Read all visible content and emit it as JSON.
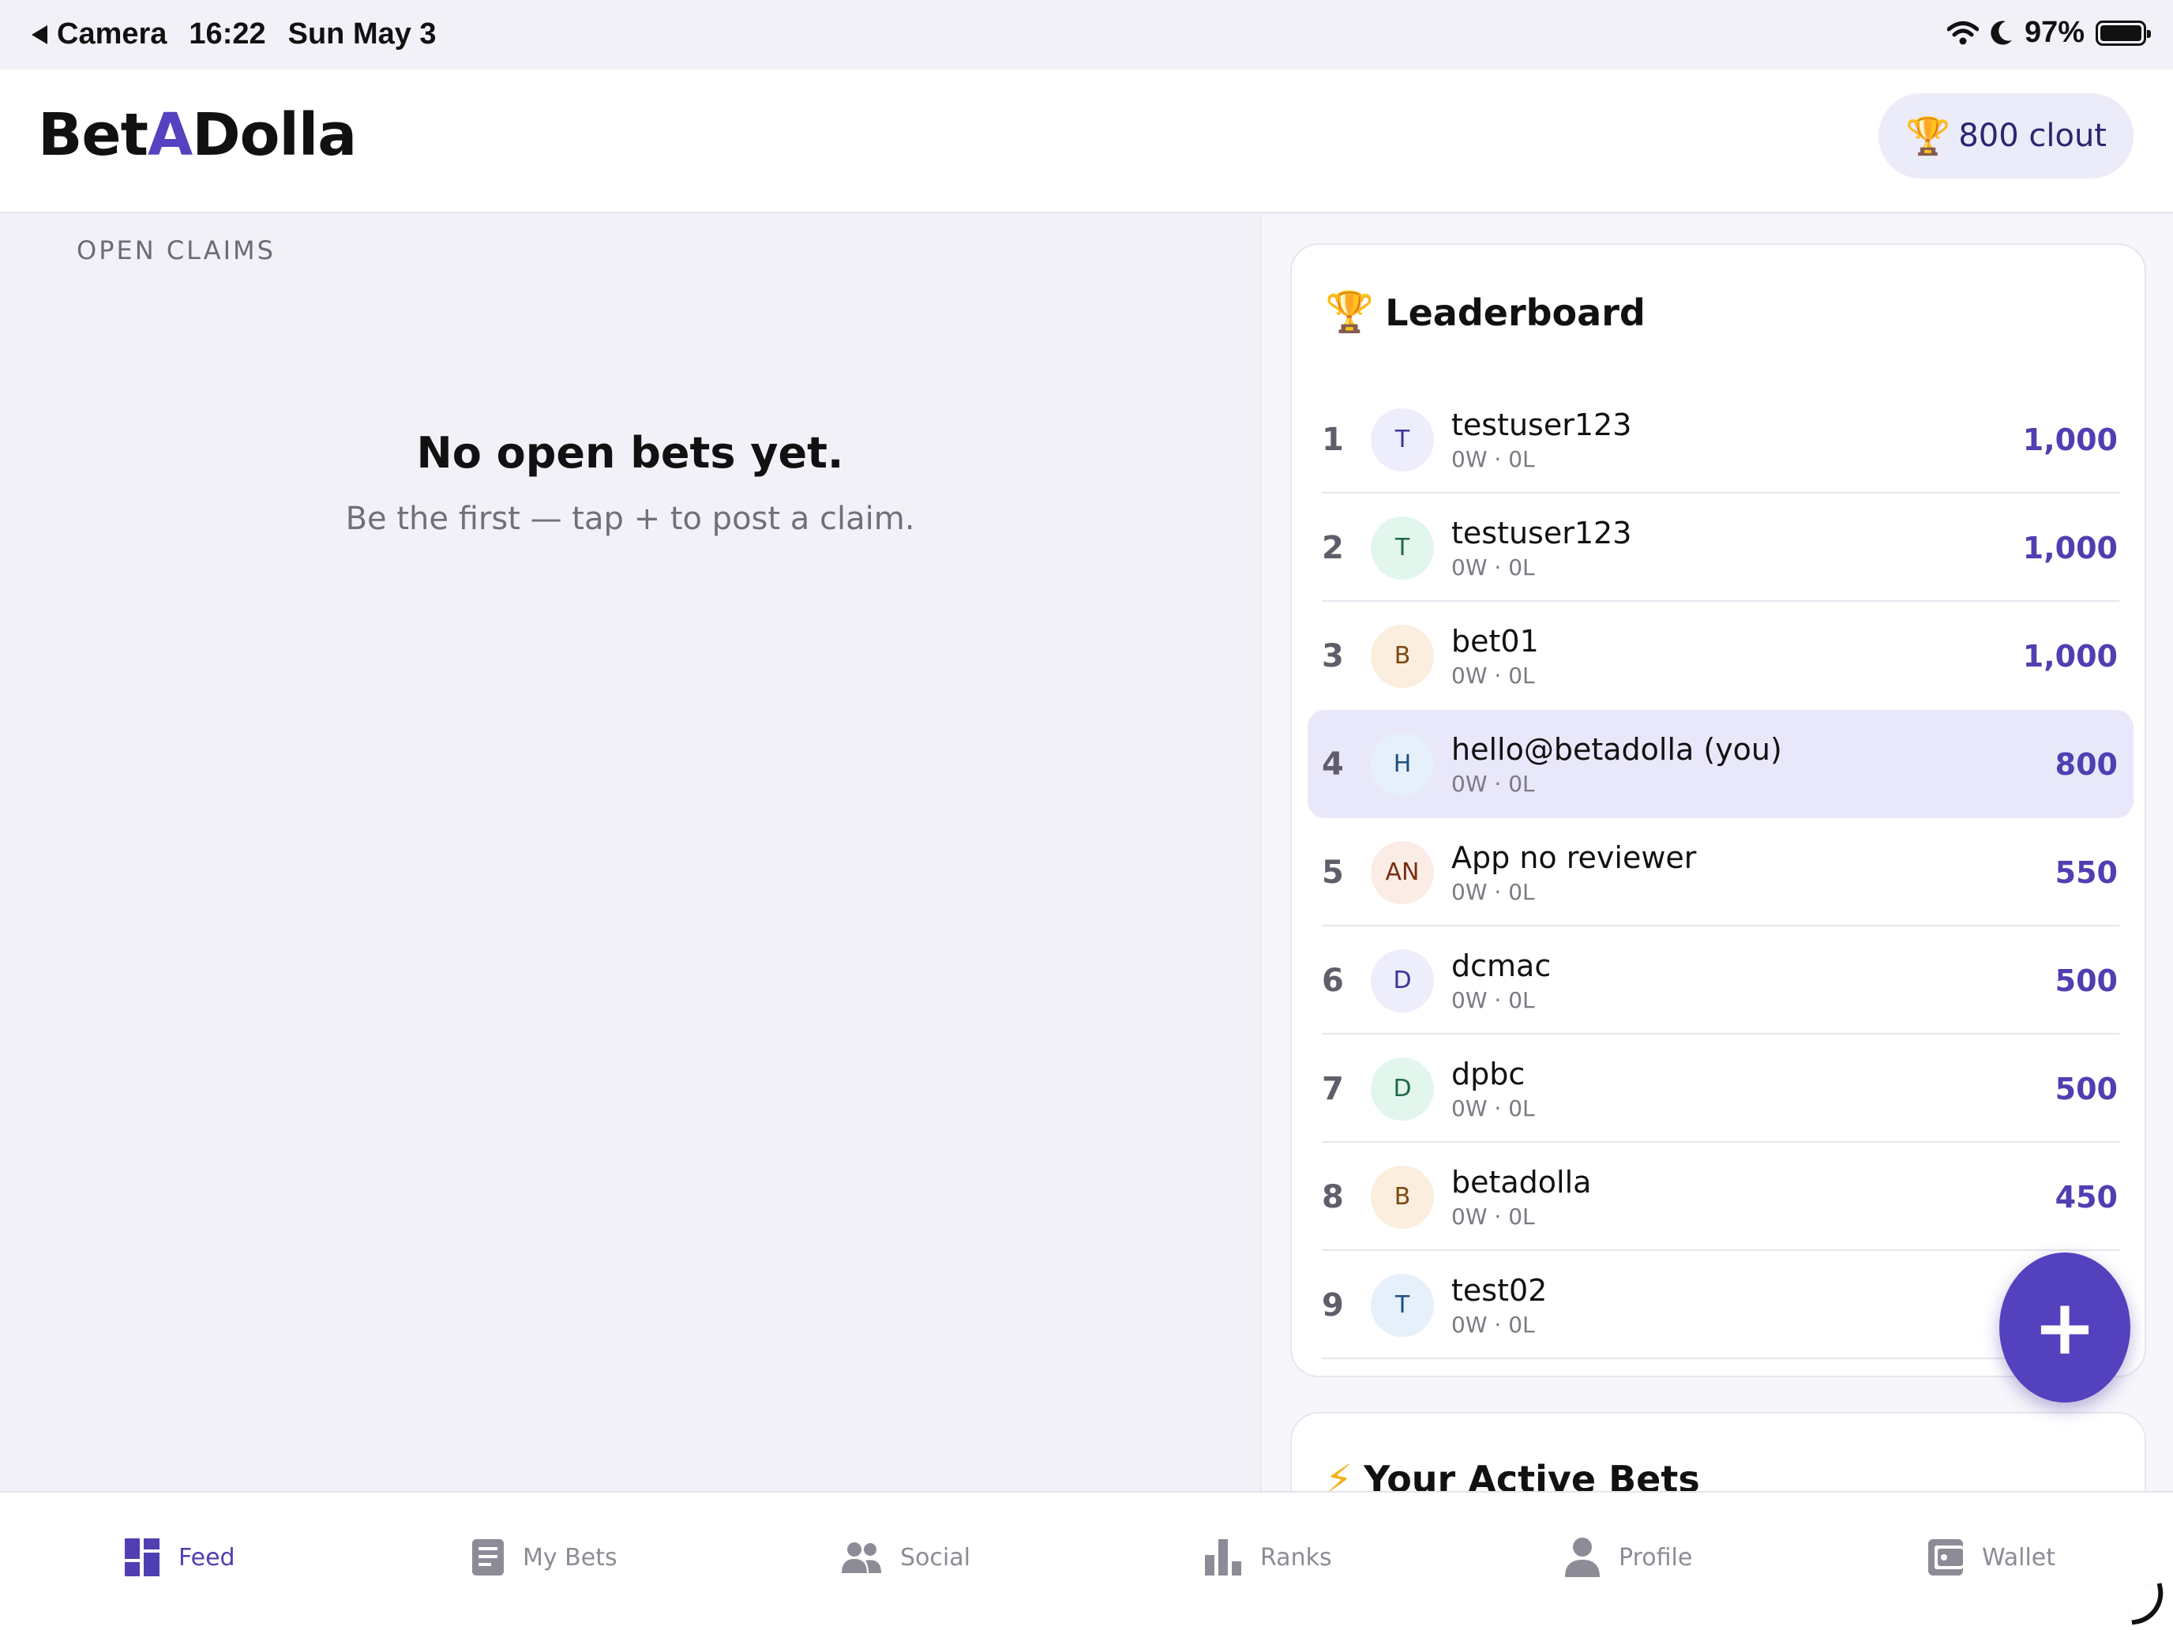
{
  "status_bar": {
    "back_app": "Camera",
    "time": "16:22",
    "date": "Sun May 3",
    "battery": "97%",
    "icons": [
      "wifi-icon",
      "moon-icon",
      "battery-icon"
    ]
  },
  "header": {
    "logo_prefix": "Bet",
    "logo_accent": "A",
    "logo_suffix": "Dolla",
    "clout_label": "800 clout",
    "clout_icon": "trophy-icon"
  },
  "feed": {
    "section_label": "OPEN CLAIMS",
    "empty_title": "No open bets yet.",
    "empty_subtitle": "Be the first — tap + to post a claim."
  },
  "leaderboard": {
    "title": "Leaderboard",
    "title_icon": "🏆",
    "rows": [
      {
        "rank": "1",
        "initials": "T",
        "name": "testuser123",
        "record": "0W · 0L",
        "score": "1,000",
        "avatar_bg": "#eeedfb",
        "avatar_fg": "#3b3496"
      },
      {
        "rank": "2",
        "initials": "T",
        "name": "testuser123",
        "record": "0W · 0L",
        "score": "1,000",
        "avatar_bg": "#e3f6ee",
        "avatar_fg": "#1f6a48"
      },
      {
        "rank": "3",
        "initials": "B",
        "name": "bet01",
        "record": "0W · 0L",
        "score": "1,000",
        "avatar_bg": "#fbeede",
        "avatar_fg": "#7a4a10"
      },
      {
        "rank": "4",
        "initials": "H",
        "name": "hello@betadolla (you)",
        "record": "0W · 0L",
        "score": "800",
        "avatar_bg": "#e6f0fb",
        "avatar_fg": "#1f4f80",
        "is_you": true
      },
      {
        "rank": "5",
        "initials": "AN",
        "name": "App no reviewer",
        "record": "0W · 0L",
        "score": "550",
        "avatar_bg": "#fbece6",
        "avatar_fg": "#7a2e10"
      },
      {
        "rank": "6",
        "initials": "D",
        "name": "dcmac",
        "record": "0W · 0L",
        "score": "500",
        "avatar_bg": "#eeedfb",
        "avatar_fg": "#3b3496"
      },
      {
        "rank": "7",
        "initials": "D",
        "name": "dpbc",
        "record": "0W · 0L",
        "score": "500",
        "avatar_bg": "#e3f6ee",
        "avatar_fg": "#1f6a48"
      },
      {
        "rank": "8",
        "initials": "B",
        "name": "betadolla",
        "record": "0W · 0L",
        "score": "450",
        "avatar_bg": "#fbeede",
        "avatar_fg": "#7a4a10"
      },
      {
        "rank": "9",
        "initials": "T",
        "name": "test02",
        "record": "0W · 0L",
        "score": "",
        "avatar_bg": "#e6f0fb",
        "avatar_fg": "#1f4f80"
      }
    ]
  },
  "active_bets": {
    "title": "Your Active Bets",
    "title_icon": "⚡"
  },
  "fab": {
    "label": "+"
  },
  "tabs": [
    {
      "label": "Feed",
      "icon": "dashboard-icon",
      "active": true
    },
    {
      "label": "My Bets",
      "icon": "document-icon",
      "active": false
    },
    {
      "label": "Social",
      "icon": "people-icon",
      "active": false
    },
    {
      "label": "Ranks",
      "icon": "bar-chart-icon",
      "active": false
    },
    {
      "label": "Profile",
      "icon": "person-icon",
      "active": false
    },
    {
      "label": "Wallet",
      "icon": "wallet-icon",
      "active": false
    }
  ],
  "colors": {
    "accent": "#5542c0",
    "score": "#4f3fb2",
    "background": "#f2f1f7"
  }
}
